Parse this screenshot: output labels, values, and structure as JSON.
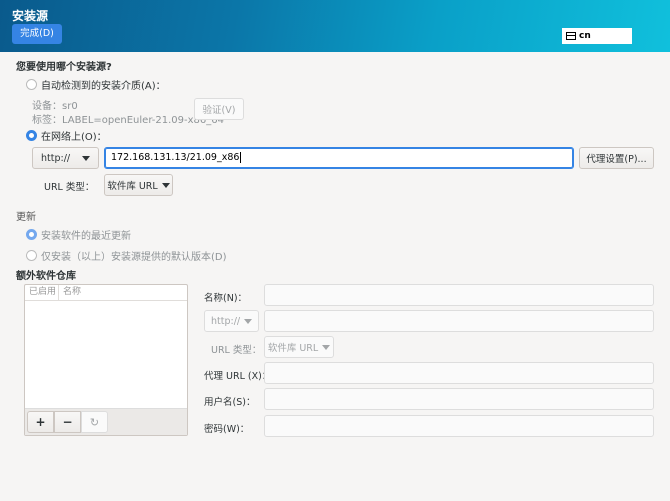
{
  "header": {
    "title": "安装源",
    "done_label": "完成(D)",
    "keyboard_layout": "cn"
  },
  "source": {
    "question": "您要使用哪个安装源?",
    "auto_label": "自动检测到的安装介质(A)：",
    "device_label": "设备：sr0",
    "tag_label": "标签：LABEL=openEuler-21.09-x86_64",
    "verify_label": "验证(V)",
    "network_label": "在网络上(O)：",
    "protocol": "http://",
    "url_value": "172.168.131.13/21.09_x86",
    "proxy_label": "代理设置(P)...",
    "url_type_label": "URL 类型：",
    "url_type_value": "软件库 URL"
  },
  "updates": {
    "heading": "更新",
    "latest_label": "安装软件的最近更新",
    "default_label": "仅安装（以上）安装源提供的默认版本(D)"
  },
  "repos": {
    "heading": "额外软件仓库",
    "col_enabled": "已启用",
    "col_name": "名称",
    "add": "+",
    "remove": "−",
    "form": {
      "name_label": "名称(N)：",
      "protocol": "http://",
      "url_type_label": "URL 类型：",
      "url_type_value": "软件库 URL",
      "proxy_label": "代理 URL (X)：",
      "user_label": "用户名(S)：",
      "password_label": "密码(W)："
    }
  },
  "colors": {
    "accent": "#3584e4"
  }
}
